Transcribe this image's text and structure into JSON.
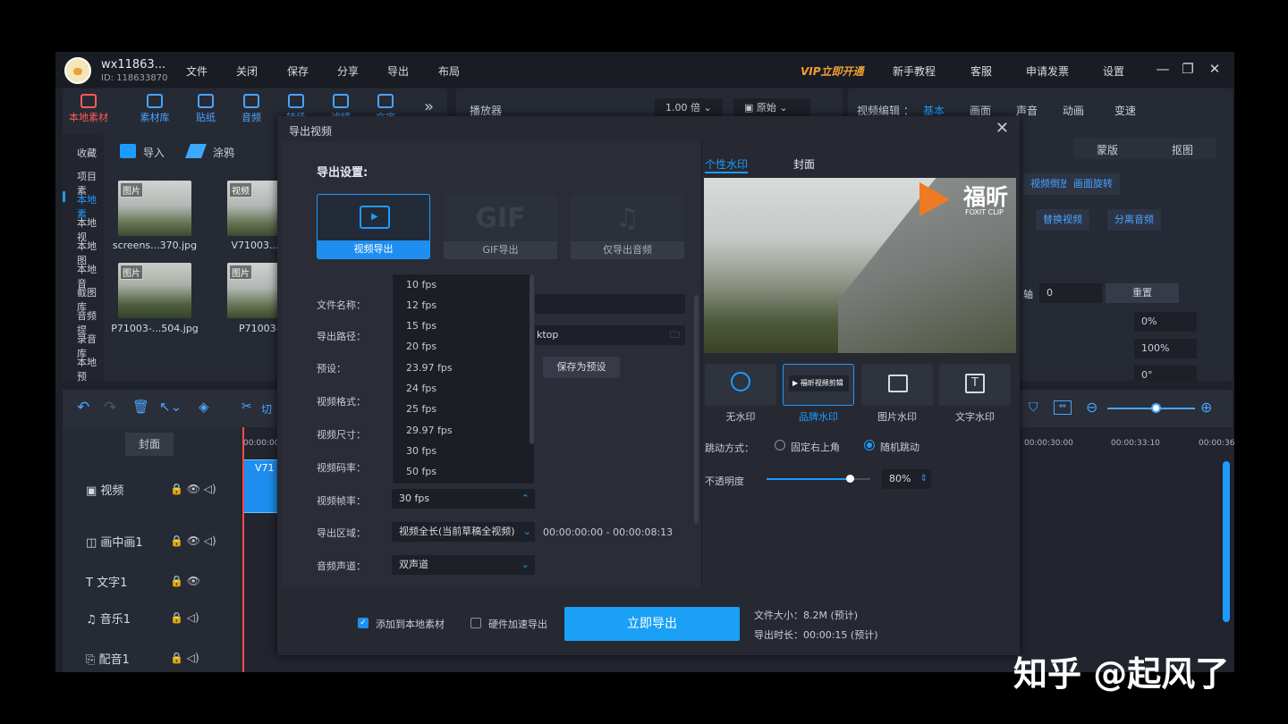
{
  "titlebar": {
    "username": "wx11863...",
    "user_id": "ID: 118633870",
    "menu": [
      "文件",
      "关闭",
      "保存",
      "分享",
      "导出",
      "布局"
    ],
    "vip": "VIP立即开通",
    "right_menu": [
      "新手教程",
      "客服",
      "申请发票",
      "设置"
    ]
  },
  "toolbar": {
    "tabs": [
      "本地素材",
      "素材库",
      "贴纸",
      "音频",
      "转场",
      "滤镜",
      "文字"
    ],
    "more": "»"
  },
  "side_nav": [
    "收藏",
    "项目素",
    "本地素",
    "本地视",
    "本地图",
    "本地音",
    "截图库",
    "音频提",
    "录音库",
    "本地预"
  ],
  "media_actions": {
    "import": "导入",
    "doodle": "涂鸦"
  },
  "media": [
    {
      "tag": "图片",
      "name": "screens...370.jpg"
    },
    {
      "tag": "视频",
      "name": "V71003..."
    },
    {
      "tag": "图片",
      "name": "P71003-...504.jpg"
    },
    {
      "tag": "图片",
      "name": "P71003-..."
    }
  ],
  "player": {
    "label": "播放器",
    "speed": "1.00 倍",
    "ratio": "原始"
  },
  "editor": {
    "label": "视频编辑 ：",
    "tabs": [
      "基本",
      "画面",
      "声音",
      "动画",
      "变速"
    ],
    "subtabs": [
      "蒙版",
      "抠图"
    ],
    "btn_reverse": "视频倒放",
    "btn_rotate": "画面旋转",
    "btn_replace": "替换视频",
    "btn_separate": "分离音频",
    "axis_label": "轴",
    "axis_value": "0",
    "reset": "重置",
    "values": [
      "0%",
      "100%",
      "0°"
    ]
  },
  "timeline": {
    "cut": "切",
    "cover": "封面",
    "ticks": [
      "00:00:00",
      "00:00:30:00",
      "00:00:33:10",
      "00:00:36"
    ],
    "clip": "V71",
    "tracks": [
      "视频",
      "画中画1",
      "文字1",
      "音乐1",
      "配音1"
    ]
  },
  "dialog": {
    "title": "导出视频",
    "section": "导出设置:",
    "cards": [
      {
        "big": "",
        "label": "视频导出"
      },
      {
        "big": "GIF",
        "label": "GIF导出"
      },
      {
        "big": "♫",
        "label": "仅导出音频"
      }
    ],
    "labels": {
      "name": "文件名称：",
      "path": "导出路径：",
      "preset": "预设：",
      "format": "视频格式：",
      "size": "视频尺寸：",
      "bitrate": "视频码率：",
      "fps": "视频帧率：",
      "area": "导出区域：",
      "channel": "音频声道："
    },
    "path_value": "ktop",
    "save_preset": "保存为预设",
    "fps_options": [
      "10 fps",
      "12 fps",
      "15 fps",
      "20 fps",
      "23.97 fps",
      "24 fps",
      "25 fps",
      "29.97 fps",
      "30 fps",
      "50 fps"
    ],
    "fps_value": "30 fps",
    "area_value": "视频全长(当前草稿全视频)",
    "area_range": "00:00:00:00 - 00:00:08:13",
    "channel_value": "双声道",
    "watermark_tabs": [
      "个性水印",
      "封面"
    ],
    "logo_cn": "福昕",
    "logo_en": "FOXIT CLIP",
    "wm_options": [
      "无水印",
      "品牌水印",
      "图片水印",
      "文字水印"
    ],
    "brand_badge": "福昕视频剪辑",
    "jump_label": "跳动方式：",
    "jump_options": [
      "固定右上角",
      "随机跳动"
    ],
    "opacity_label": "不透明度",
    "opacity_value": "80%",
    "opacity": 0.8,
    "add_local": "添加到本地素材",
    "hw_accel": "硬件加速导出",
    "export_btn": "立即导出",
    "file_size": "文件大小：8.2M (预计)",
    "duration": "导出时长：00:00:15 (预计)"
  },
  "watermark_text": "知乎 @起风了"
}
